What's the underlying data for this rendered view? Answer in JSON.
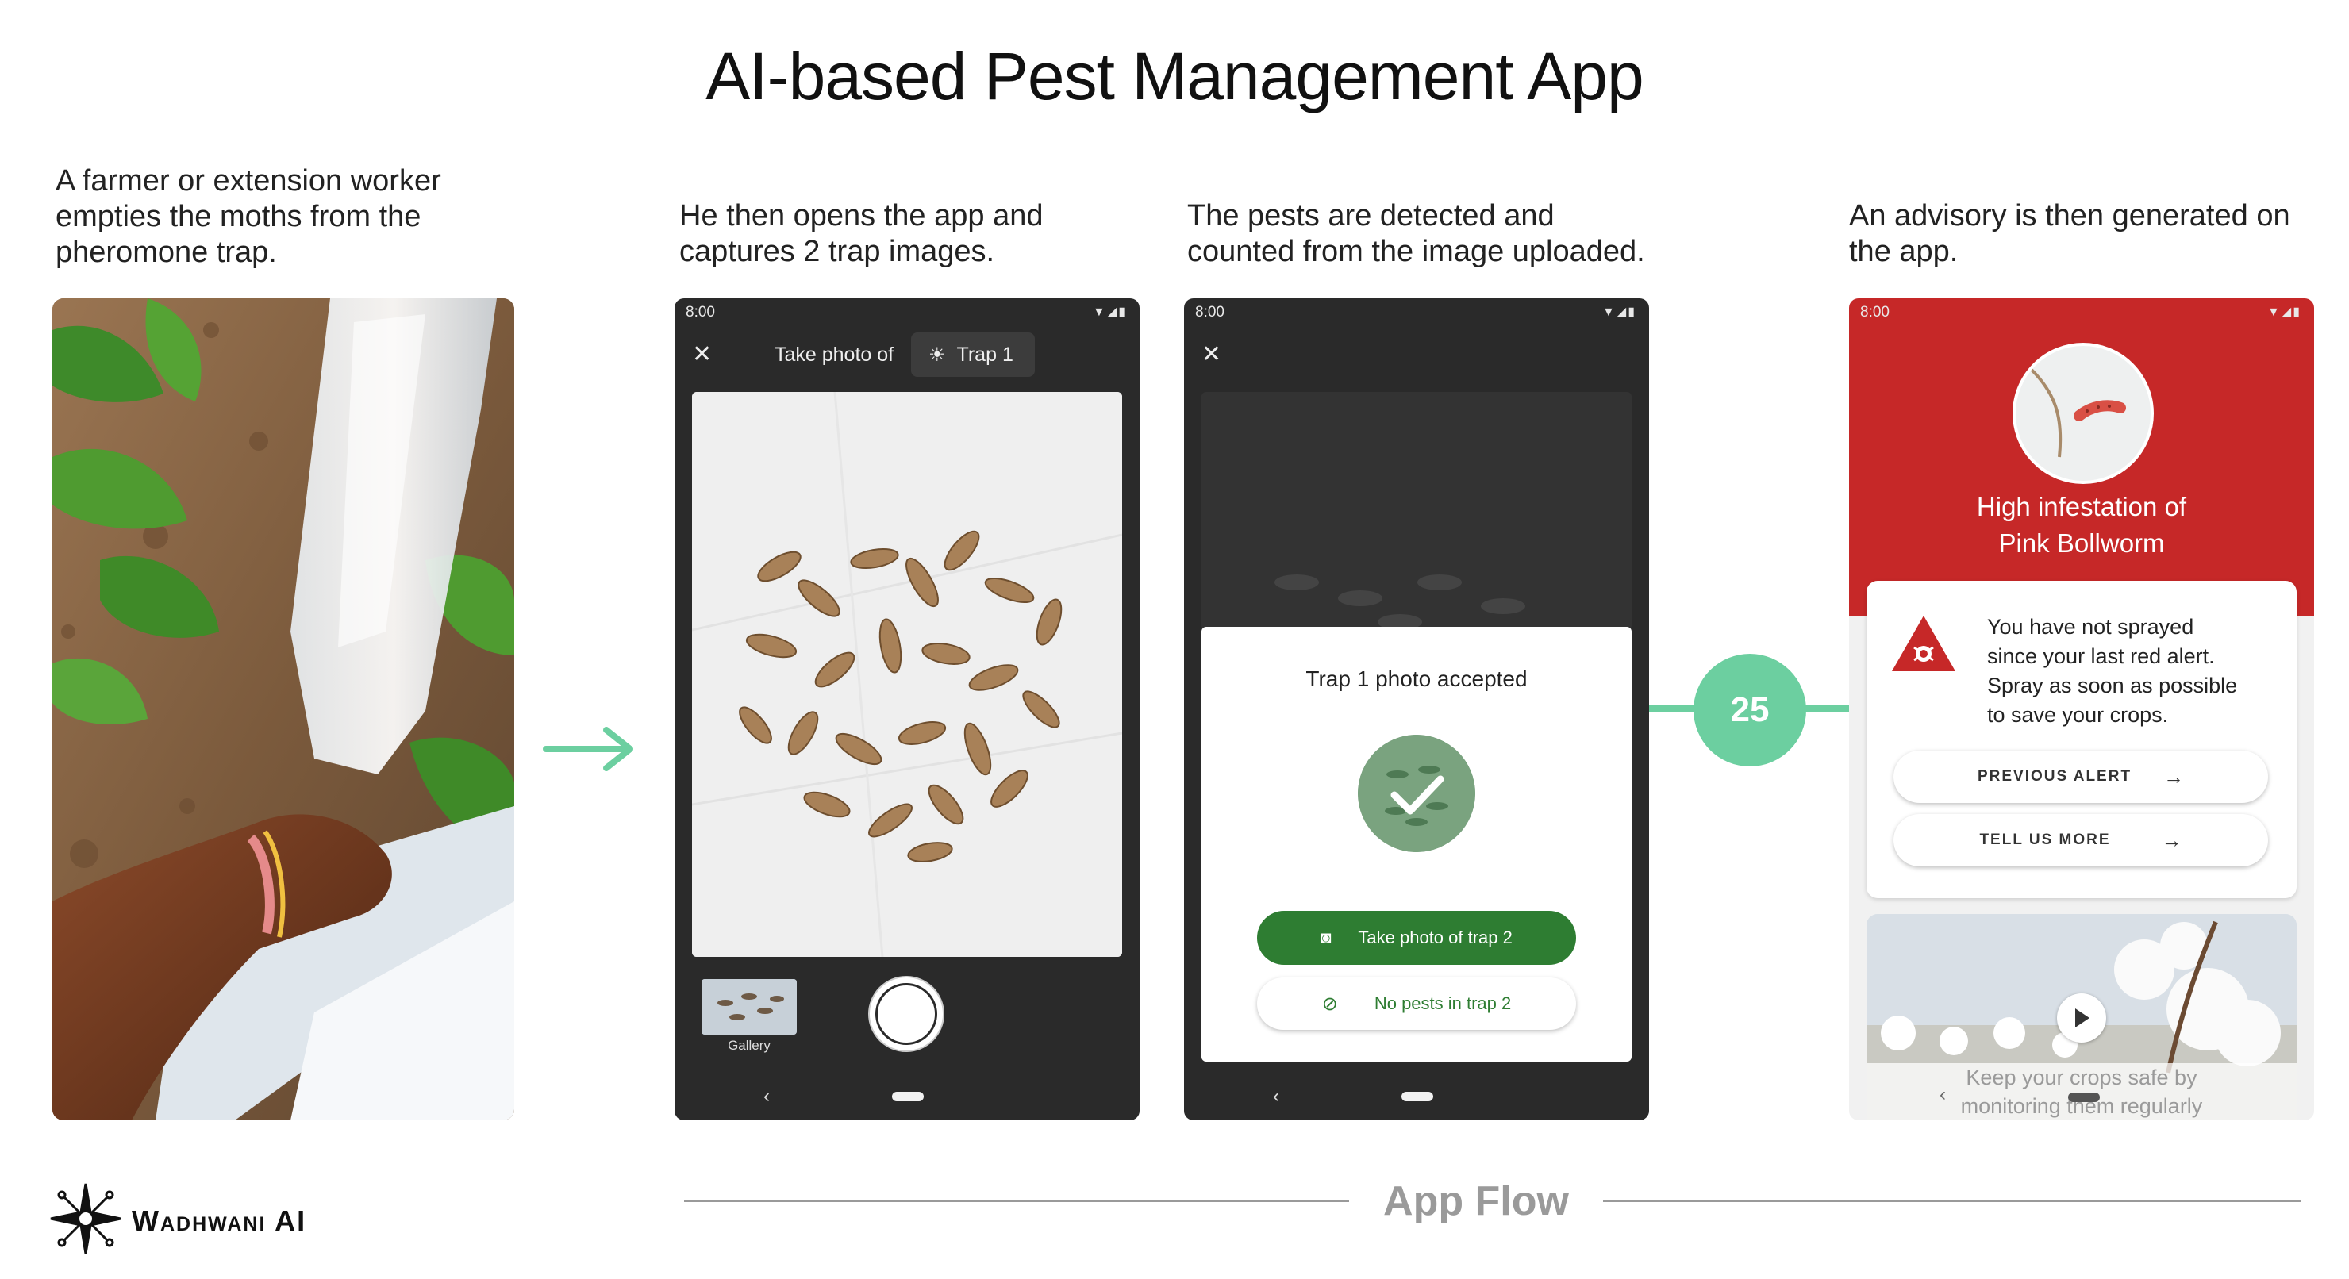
{
  "title": "AI-based Pest Management App",
  "steps": [
    {
      "caption": [
        "A farmer or extension worker",
        "empties the moths from the",
        "pheromone trap."
      ]
    },
    {
      "caption": [
        "He then opens the app and",
        "captures 2 trap images."
      ]
    },
    {
      "caption": [
        "The pests are detected and",
        "counted from the image uploaded."
      ]
    },
    {
      "caption": [
        "An advisory is then generated on",
        "the app."
      ]
    }
  ],
  "phone_status": {
    "time": "8:00"
  },
  "screen1": {
    "prompt": "Take photo of",
    "trap_chip": "Trap 1",
    "gallery_label": "Gallery"
  },
  "screen2": {
    "dialog_title": "Trap 1 photo accepted",
    "primary_button": "Take photo of trap 2",
    "secondary_button": "No pests in trap 2"
  },
  "pest_count": "25",
  "screen3": {
    "header_title": [
      "High infestation of",
      "Pink Bollworm"
    ],
    "alert_text": [
      "You have not sprayed",
      "since your last red alert.",
      "Spray as soon as possible",
      "to save your crops."
    ],
    "previous_alert_button": "PREVIOUS ALERT",
    "tell_us_more_button": "TELL US MORE",
    "video_caption": [
      "Keep your crops safe by",
      "monitoring them regularly"
    ]
  },
  "footer": {
    "brand": "Wadhwani AI",
    "section_label": "App Flow"
  },
  "colors": {
    "accent_green": "#6ccfa0",
    "button_green": "#2e7d32",
    "alert_red": "#c62828",
    "phone_dark": "#2a2a2a"
  }
}
